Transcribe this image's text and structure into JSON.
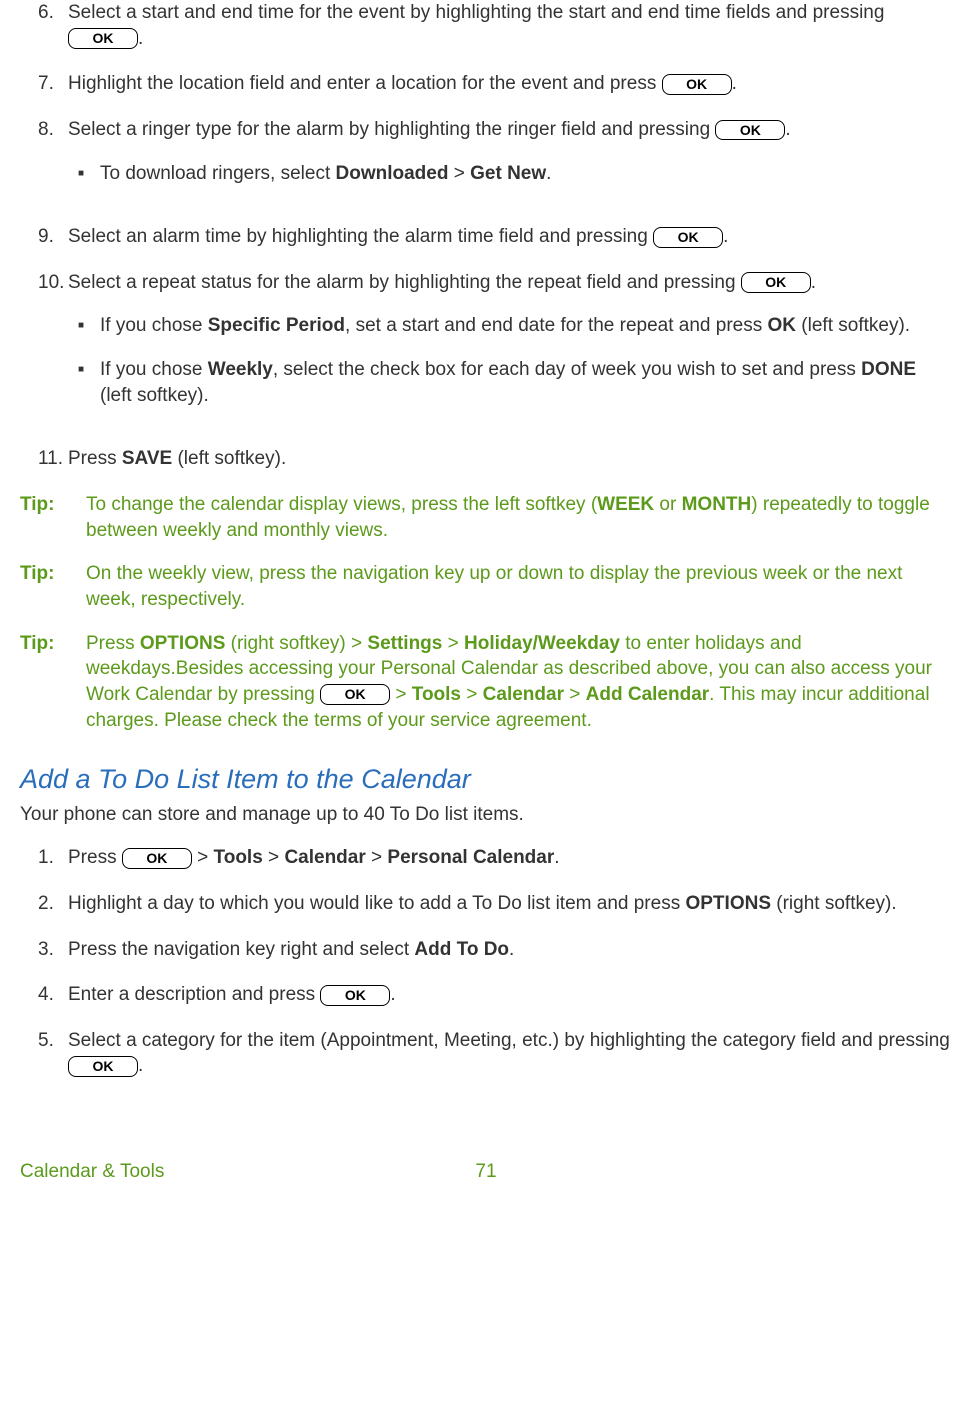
{
  "okLabel": "OK",
  "steps_a": {
    "6": {
      "num": "6.",
      "text_before": "Select a start and end time for the event by highlighting the start and end time fields and pressing ",
      "text_after": "."
    },
    "7": {
      "num": "7.",
      "text_before": "Highlight the location field and enter a location for the event and press ",
      "text_after": "."
    },
    "8": {
      "num": "8.",
      "text_before": "Select a ringer type for the alarm by highlighting the ringer field and pressing ",
      "text_after": ".",
      "sub": {
        "a": {
          "before": "To download ringers, select ",
          "b1": "Downloaded",
          "mid": " > ",
          "b2": "Get New",
          "after": "."
        }
      }
    },
    "9": {
      "num": "9.",
      "text_before": "Select an alarm time by highlighting the alarm time field and pressing ",
      "text_after": "."
    },
    "10": {
      "num": "10.",
      "text_before": "Select a repeat status for the alarm by highlighting the repeat field and pressing ",
      "text_after": ".",
      "sub": {
        "a": {
          "before": "If you chose ",
          "b1": "Specific Period",
          "mid": ", set a start and end date for the repeat and press ",
          "b2": "OK",
          "after": " (left softkey)."
        },
        "b": {
          "before": "If you chose ",
          "b1": "Weekly",
          "mid": ", select the check box for each day of week you wish to set and press ",
          "b2": "DONE",
          "after": " (left softkey)."
        }
      }
    },
    "11": {
      "num": "11.",
      "before": "Press ",
      "b1": "SAVE",
      "after": " (left softkey)."
    }
  },
  "tips": {
    "label": "Tip:",
    "1": {
      "t1": "To change the calendar display views, press the left softkey (",
      "b1": "WEEK",
      "t2": " or ",
      "b2": "MONTH",
      "t3": ") repeatedly to toggle between weekly and monthly views."
    },
    "2": {
      "t1": "On the weekly view, press the navigation key up or down to display the previous week or the next week, respectively."
    },
    "3": {
      "t1": "Press ",
      "b1": "OPTIONS",
      "t2": " (right softkey) > ",
      "b2": "Settings",
      "t3": " > ",
      "b3": "Holiday/Weekday",
      "t4": " to enter holidays and weekdays.Besides accessing your Personal Calendar as described above, you can also access your Work Calendar by pressing ",
      "t5": " > ",
      "b4": "Tools",
      "t6": " > ",
      "b5": "Calendar",
      "t7": " > ",
      "b6": "Add Calendar",
      "t8": ". This may incur additional charges. Please check the terms of your service agreement."
    }
  },
  "heading": "Add a To Do List Item to the Calendar",
  "intro": "Your phone can store and manage up to 40 To Do list items.",
  "steps_b": {
    "1": {
      "num": "1.",
      "t1": "Press ",
      "t2": " > ",
      "b1": "Tools",
      "t3": " > ",
      "b2": "Calendar",
      "t4": " > ",
      "b3": "Personal Calendar",
      "t5": "."
    },
    "2": {
      "num": "2.",
      "t1": "Highlight a day to which you would like to add a To Do list item and press ",
      "b1": "OPTIONS",
      "t2": " (right softkey)."
    },
    "3": {
      "num": "3.",
      "t1": "Press the navigation key right and select ",
      "b1": "Add To Do",
      "t2": "."
    },
    "4": {
      "num": "4.",
      "t1": "Enter a description and press ",
      "t2": "."
    },
    "5": {
      "num": "5.",
      "t1": "Select a category for the item (Appointment, Meeting, etc.) by highlighting the category field and pressing ",
      "t2": "."
    }
  },
  "footer": {
    "section": "Calendar & Tools",
    "page": "71"
  }
}
